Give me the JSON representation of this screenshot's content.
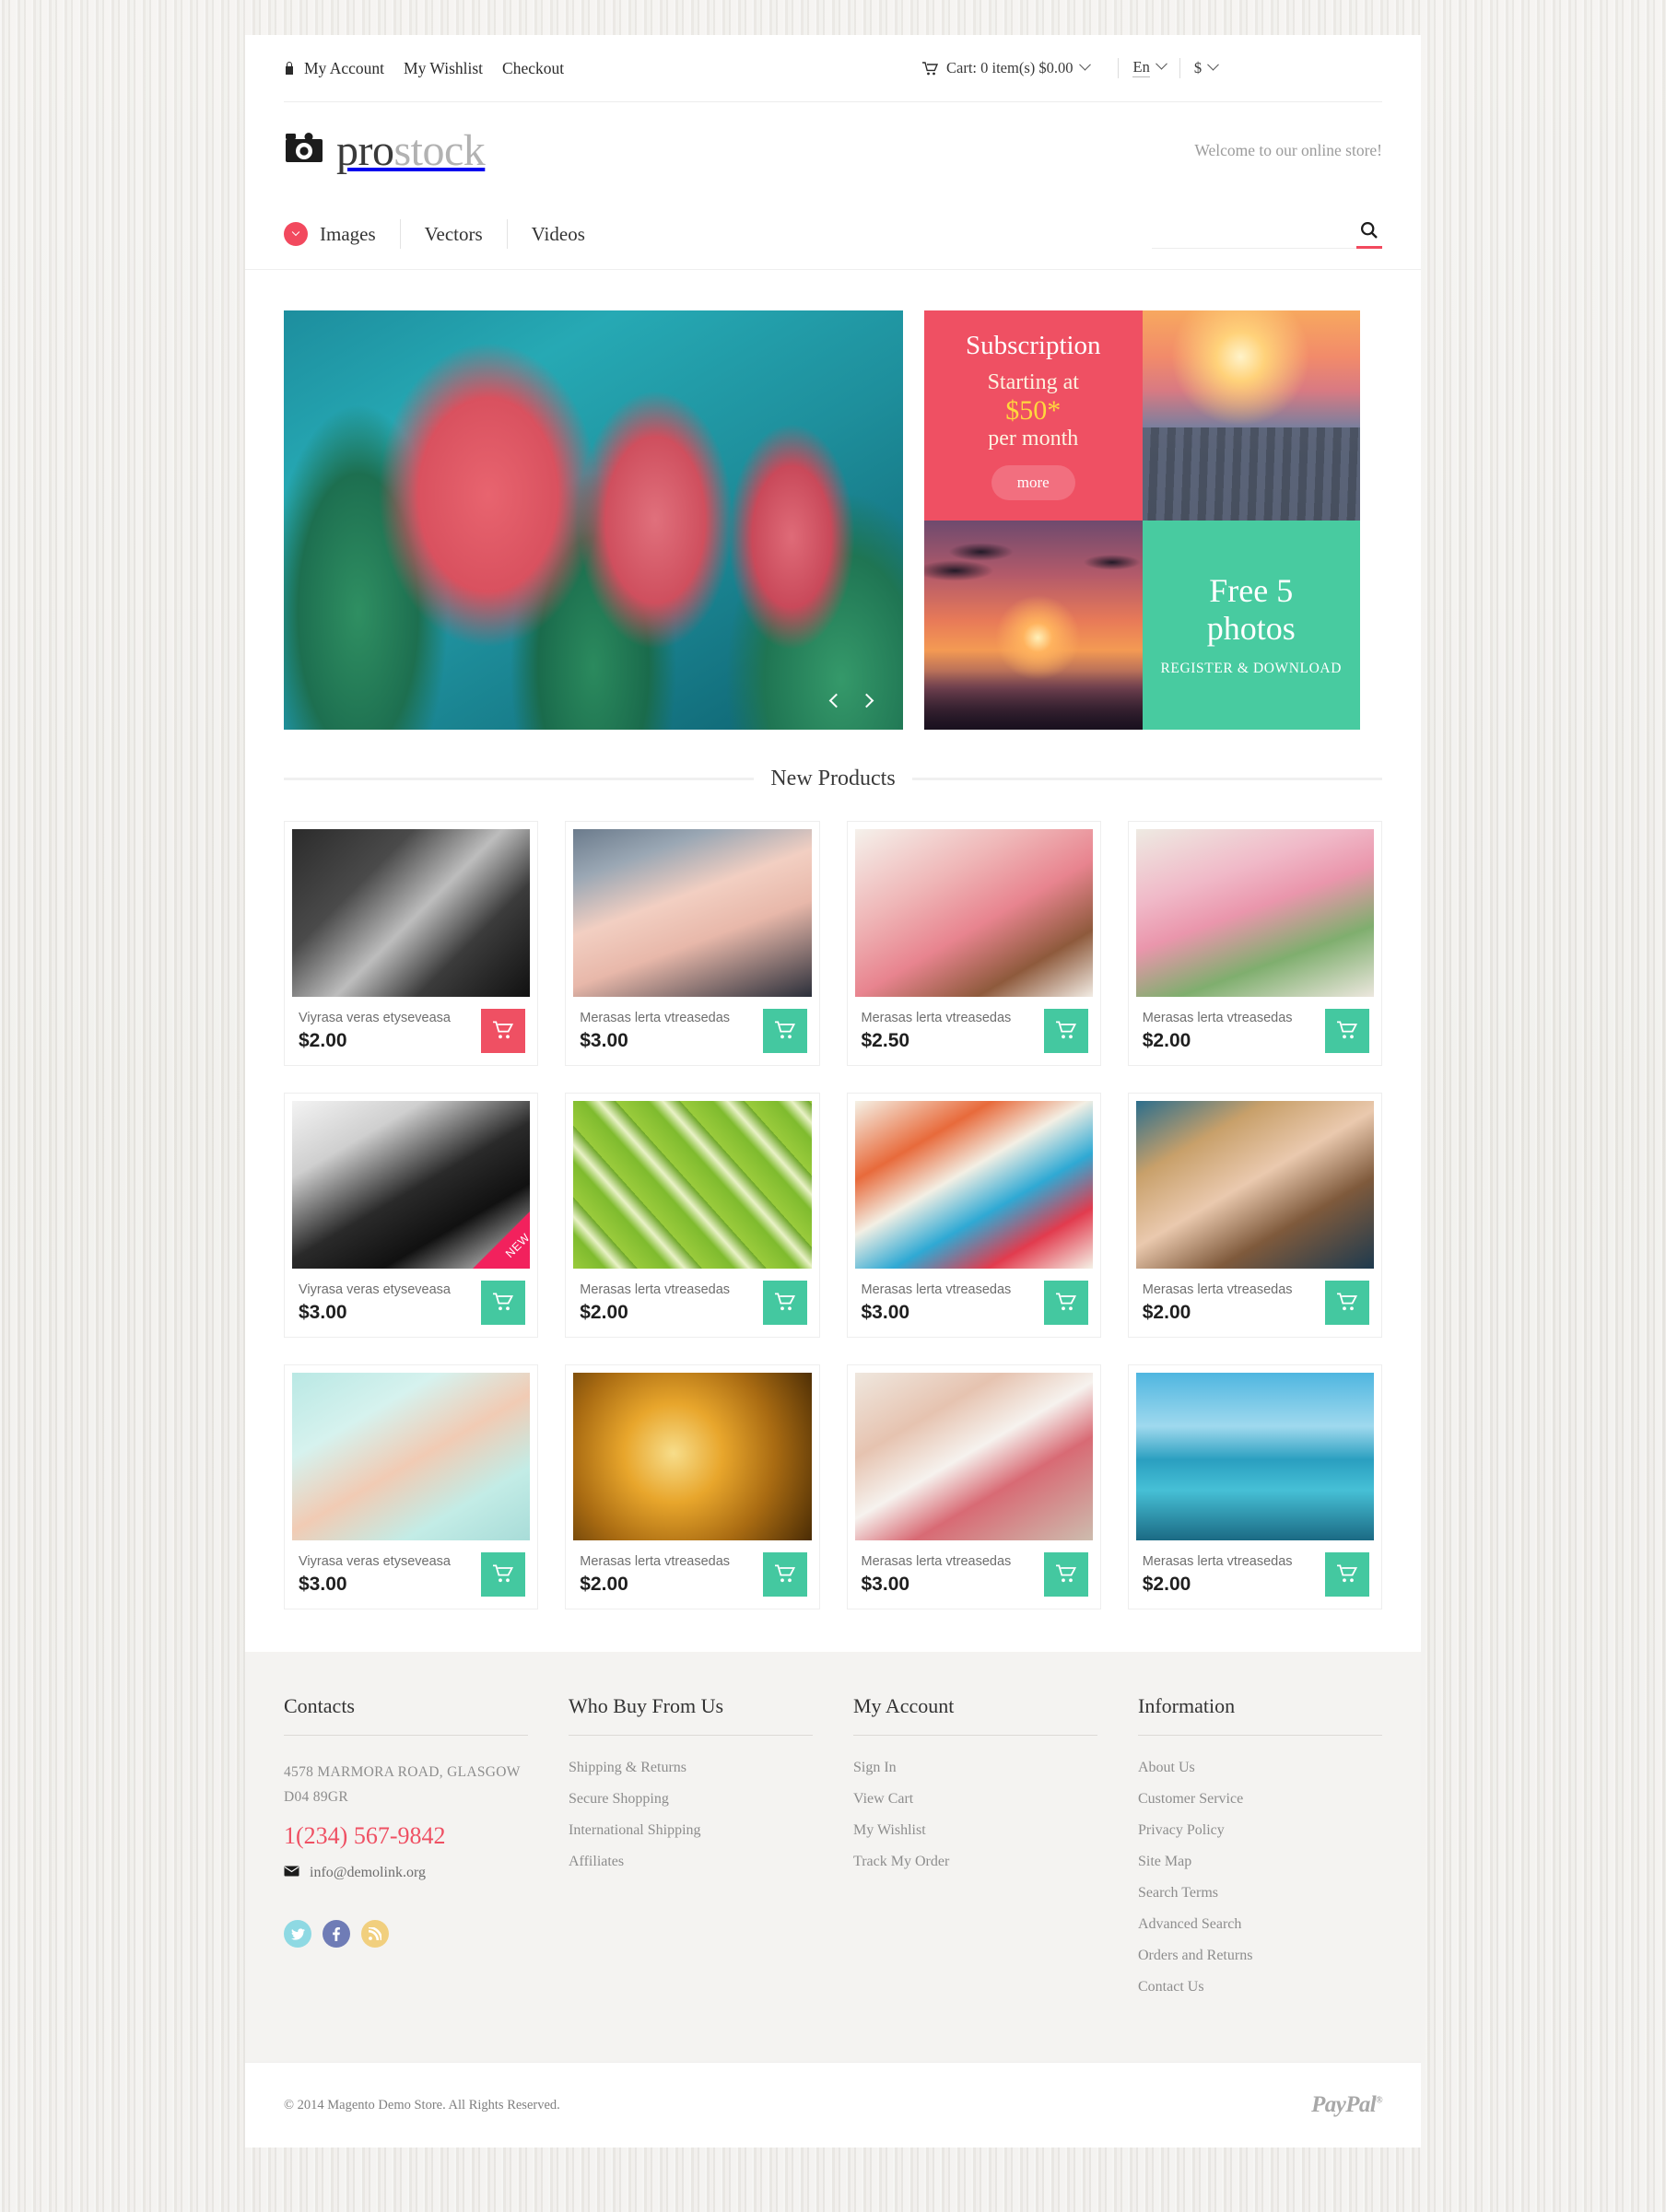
{
  "topbar": {
    "lock_icon": "lock-icon",
    "links": [
      {
        "label": "My Account"
      },
      {
        "label": "My Wishlist"
      },
      {
        "label": "Checkout"
      }
    ],
    "cart": {
      "icon": "cart-icon",
      "label": "Cart: 0 item(s) $0.00"
    },
    "language": {
      "label": "En"
    },
    "currency": {
      "label": "$"
    }
  },
  "header": {
    "logo": {
      "icon": "camera-icon",
      "part1": "pro",
      "part2": "stock"
    },
    "welcome": "Welcome to our online store!"
  },
  "nav": {
    "bullet_icon": "chevron-down-icon",
    "items": [
      {
        "label": "Images"
      },
      {
        "label": "Vectors"
      },
      {
        "label": "Videos"
      }
    ],
    "search": {
      "value": "",
      "placeholder": "",
      "icon": "search-icon"
    }
  },
  "hero": {
    "slider": {
      "prev_icon": "chevron-left-icon",
      "next_icon": "chevron-right-icon",
      "image": "pink-tulips-photo"
    },
    "promo_subscription": {
      "title": "Subscription",
      "line1": "Starting at",
      "price": "$50*",
      "line2": "per month",
      "button": "more"
    },
    "promo_pier": {
      "image": "tropical-pier-sunset-photo"
    },
    "promo_palm": {
      "image": "palm-trees-sunset-photo"
    },
    "promo_free": {
      "title_line1": "Free 5",
      "title_line2": "photos",
      "subtitle": "REGISTER & DOWNLOAD"
    }
  },
  "new_products": {
    "heading": "New Products",
    "items": [
      {
        "name": "Viyrasa veras etyseveasa",
        "price": "$2.00",
        "img": "im-car",
        "cart_color": "red",
        "badge": null
      },
      {
        "name": "Merasas lerta vtreasedas",
        "price": "$3.00",
        "img": "im-nails",
        "cart_color": "green",
        "badge": null
      },
      {
        "name": "Merasas lerta vtreasedas",
        "price": "$2.50",
        "img": "im-cupcake",
        "cart_color": "green",
        "badge": null
      },
      {
        "name": "Merasas lerta vtreasedas",
        "price": "$2.00",
        "img": "im-tulipvase",
        "cart_color": "green",
        "badge": null
      },
      {
        "name": "Viyrasa veras etyseveasa",
        "price": "$3.00",
        "img": "im-stones",
        "cart_color": "green",
        "badge": "NEW"
      },
      {
        "name": "Merasas lerta vtreasedas",
        "price": "$2.00",
        "img": "im-kiwi",
        "cart_color": "green",
        "badge": null
      },
      {
        "name": "Merasas lerta vtreasedas",
        "price": "$3.00",
        "img": "im-candy",
        "cart_color": "green",
        "badge": null
      },
      {
        "name": "Merasas lerta vtreasedas",
        "price": "$2.00",
        "img": "im-face",
        "cart_color": "green",
        "badge": null
      },
      {
        "name": "Viyrasa veras etyseveasa",
        "price": "$3.00",
        "img": "im-baby",
        "cart_color": "green",
        "badge": null
      },
      {
        "name": "Merasas lerta vtreasedas",
        "price": "$2.00",
        "img": "im-wine",
        "cart_color": "green",
        "badge": null
      },
      {
        "name": "Merasas lerta vtreasedas",
        "price": "$3.00",
        "img": "im-sunglass",
        "cart_color": "green",
        "badge": null
      },
      {
        "name": "Merasas lerta vtreasedas",
        "price": "$2.00",
        "img": "im-boat",
        "cart_color": "green",
        "badge": null
      }
    ]
  },
  "footer": {
    "contacts": {
      "title": "Contacts",
      "address_line1": "4578 MARMORA ROAD, GLASGOW",
      "address_line2": "D04 89GR",
      "phone": "1(234) 567-9842",
      "email": "info@demolink.org",
      "email_icon": "envelope-icon",
      "socials": [
        {
          "name": "twitter-icon"
        },
        {
          "name": "facebook-icon"
        },
        {
          "name": "rss-icon"
        }
      ]
    },
    "who_buy": {
      "title": "Who Buy From Us",
      "links": [
        "Shipping & Returns",
        "Secure Shopping",
        "International Shipping",
        "Affiliates"
      ]
    },
    "my_account": {
      "title": "My Account",
      "links": [
        "Sign In",
        "View Cart",
        "My Wishlist",
        "Track My Order"
      ]
    },
    "information": {
      "title": "Information",
      "links": [
        "About Us",
        "Customer Service",
        "Privacy Policy",
        "Site Map",
        "Search Terms",
        "Advanced Search",
        "Orders and Returns",
        "Contact Us"
      ]
    }
  },
  "copyright": {
    "text": "© 2014 Magento Demo Store. All Rights Reserved.",
    "paypal": "PayPal"
  },
  "colors": {
    "accent_red": "#ef5063",
    "accent_green": "#44c8a0",
    "badge_pink": "#f2215d",
    "yellow": "#ffd83d"
  }
}
